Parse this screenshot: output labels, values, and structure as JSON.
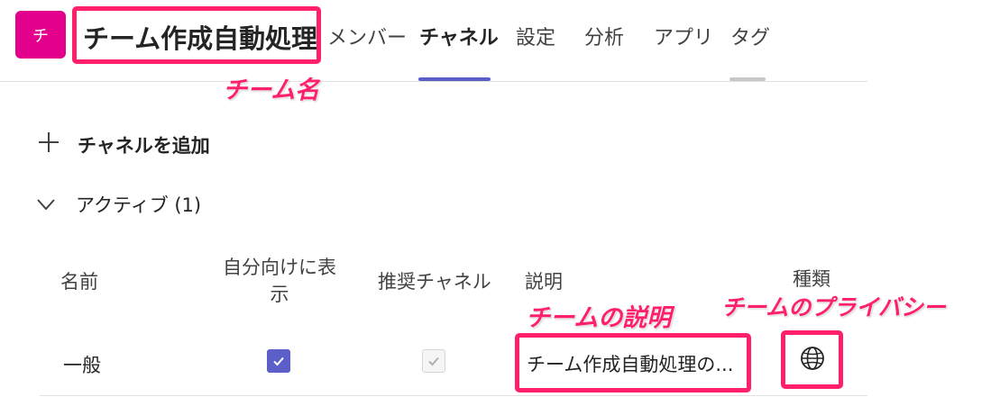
{
  "header": {
    "avatar_initial": "チ",
    "team_name": "チーム作成自動処理",
    "tabs": [
      {
        "label": "メンバー"
      },
      {
        "label": "チャネル"
      },
      {
        "label": "設定"
      },
      {
        "label": "分析"
      },
      {
        "label": "アプリ"
      },
      {
        "label": "タグ"
      }
    ],
    "active_tab": "チャネル"
  },
  "actions": {
    "add_channel_label": "チャネルを追加"
  },
  "section": {
    "title": "アクティブ (1)"
  },
  "table": {
    "columns": {
      "name": "名前",
      "show_for_me_line1": "自分向けに表",
      "show_for_me_line2": "示",
      "recommended": "推奨チャネル",
      "description": "説明",
      "type": "種類"
    },
    "rows": [
      {
        "name": "一般",
        "show_for_me": true,
        "recommended": true,
        "description": "チーム作成自動処理の...",
        "type_icon": "globe-icon"
      }
    ]
  },
  "annotations": {
    "team_name_label": "チーム名",
    "description_label": "チームの説明",
    "privacy_label": "チームのプライバシー",
    "highlight_color": "#ff1f6a"
  },
  "colors": {
    "brand": "#5b5fc7",
    "avatar": "#e3008c"
  }
}
